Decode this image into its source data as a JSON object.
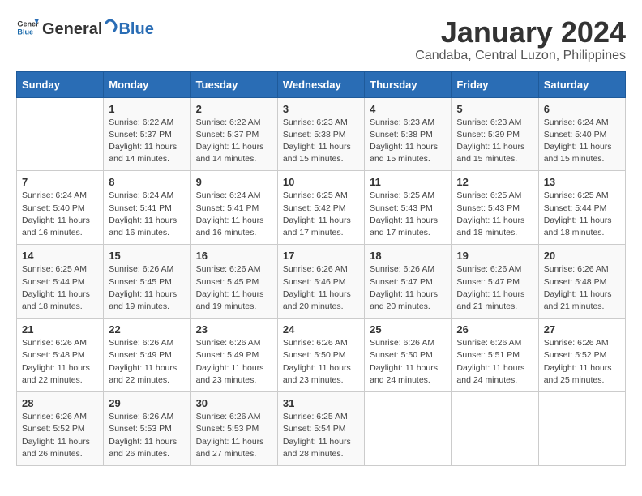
{
  "header": {
    "logo": {
      "text_general": "General",
      "text_blue": "Blue"
    },
    "title": "January 2024",
    "subtitle": "Candaba, Central Luzon, Philippines"
  },
  "calendar": {
    "days_of_week": [
      "Sunday",
      "Monday",
      "Tuesday",
      "Wednesday",
      "Thursday",
      "Friday",
      "Saturday"
    ],
    "weeks": [
      [
        {
          "day": "",
          "info": ""
        },
        {
          "day": "1",
          "info": "Sunrise: 6:22 AM\nSunset: 5:37 PM\nDaylight: 11 hours\nand 14 minutes."
        },
        {
          "day": "2",
          "info": "Sunrise: 6:22 AM\nSunset: 5:37 PM\nDaylight: 11 hours\nand 14 minutes."
        },
        {
          "day": "3",
          "info": "Sunrise: 6:23 AM\nSunset: 5:38 PM\nDaylight: 11 hours\nand 15 minutes."
        },
        {
          "day": "4",
          "info": "Sunrise: 6:23 AM\nSunset: 5:38 PM\nDaylight: 11 hours\nand 15 minutes."
        },
        {
          "day": "5",
          "info": "Sunrise: 6:23 AM\nSunset: 5:39 PM\nDaylight: 11 hours\nand 15 minutes."
        },
        {
          "day": "6",
          "info": "Sunrise: 6:24 AM\nSunset: 5:40 PM\nDaylight: 11 hours\nand 15 minutes."
        }
      ],
      [
        {
          "day": "7",
          "info": "Sunrise: 6:24 AM\nSunset: 5:40 PM\nDaylight: 11 hours\nand 16 minutes."
        },
        {
          "day": "8",
          "info": "Sunrise: 6:24 AM\nSunset: 5:41 PM\nDaylight: 11 hours\nand 16 minutes."
        },
        {
          "day": "9",
          "info": "Sunrise: 6:24 AM\nSunset: 5:41 PM\nDaylight: 11 hours\nand 16 minutes."
        },
        {
          "day": "10",
          "info": "Sunrise: 6:25 AM\nSunset: 5:42 PM\nDaylight: 11 hours\nand 17 minutes."
        },
        {
          "day": "11",
          "info": "Sunrise: 6:25 AM\nSunset: 5:43 PM\nDaylight: 11 hours\nand 17 minutes."
        },
        {
          "day": "12",
          "info": "Sunrise: 6:25 AM\nSunset: 5:43 PM\nDaylight: 11 hours\nand 18 minutes."
        },
        {
          "day": "13",
          "info": "Sunrise: 6:25 AM\nSunset: 5:44 PM\nDaylight: 11 hours\nand 18 minutes."
        }
      ],
      [
        {
          "day": "14",
          "info": "Sunrise: 6:25 AM\nSunset: 5:44 PM\nDaylight: 11 hours\nand 18 minutes."
        },
        {
          "day": "15",
          "info": "Sunrise: 6:26 AM\nSunset: 5:45 PM\nDaylight: 11 hours\nand 19 minutes."
        },
        {
          "day": "16",
          "info": "Sunrise: 6:26 AM\nSunset: 5:45 PM\nDaylight: 11 hours\nand 19 minutes."
        },
        {
          "day": "17",
          "info": "Sunrise: 6:26 AM\nSunset: 5:46 PM\nDaylight: 11 hours\nand 20 minutes."
        },
        {
          "day": "18",
          "info": "Sunrise: 6:26 AM\nSunset: 5:47 PM\nDaylight: 11 hours\nand 20 minutes."
        },
        {
          "day": "19",
          "info": "Sunrise: 6:26 AM\nSunset: 5:47 PM\nDaylight: 11 hours\nand 21 minutes."
        },
        {
          "day": "20",
          "info": "Sunrise: 6:26 AM\nSunset: 5:48 PM\nDaylight: 11 hours\nand 21 minutes."
        }
      ],
      [
        {
          "day": "21",
          "info": "Sunrise: 6:26 AM\nSunset: 5:48 PM\nDaylight: 11 hours\nand 22 minutes."
        },
        {
          "day": "22",
          "info": "Sunrise: 6:26 AM\nSunset: 5:49 PM\nDaylight: 11 hours\nand 22 minutes."
        },
        {
          "day": "23",
          "info": "Sunrise: 6:26 AM\nSunset: 5:49 PM\nDaylight: 11 hours\nand 23 minutes."
        },
        {
          "day": "24",
          "info": "Sunrise: 6:26 AM\nSunset: 5:50 PM\nDaylight: 11 hours\nand 23 minutes."
        },
        {
          "day": "25",
          "info": "Sunrise: 6:26 AM\nSunset: 5:50 PM\nDaylight: 11 hours\nand 24 minutes."
        },
        {
          "day": "26",
          "info": "Sunrise: 6:26 AM\nSunset: 5:51 PM\nDaylight: 11 hours\nand 24 minutes."
        },
        {
          "day": "27",
          "info": "Sunrise: 6:26 AM\nSunset: 5:52 PM\nDaylight: 11 hours\nand 25 minutes."
        }
      ],
      [
        {
          "day": "28",
          "info": "Sunrise: 6:26 AM\nSunset: 5:52 PM\nDaylight: 11 hours\nand 26 minutes."
        },
        {
          "day": "29",
          "info": "Sunrise: 6:26 AM\nSunset: 5:53 PM\nDaylight: 11 hours\nand 26 minutes."
        },
        {
          "day": "30",
          "info": "Sunrise: 6:26 AM\nSunset: 5:53 PM\nDaylight: 11 hours\nand 27 minutes."
        },
        {
          "day": "31",
          "info": "Sunrise: 6:25 AM\nSunset: 5:54 PM\nDaylight: 11 hours\nand 28 minutes."
        },
        {
          "day": "",
          "info": ""
        },
        {
          "day": "",
          "info": ""
        },
        {
          "day": "",
          "info": ""
        }
      ]
    ]
  }
}
